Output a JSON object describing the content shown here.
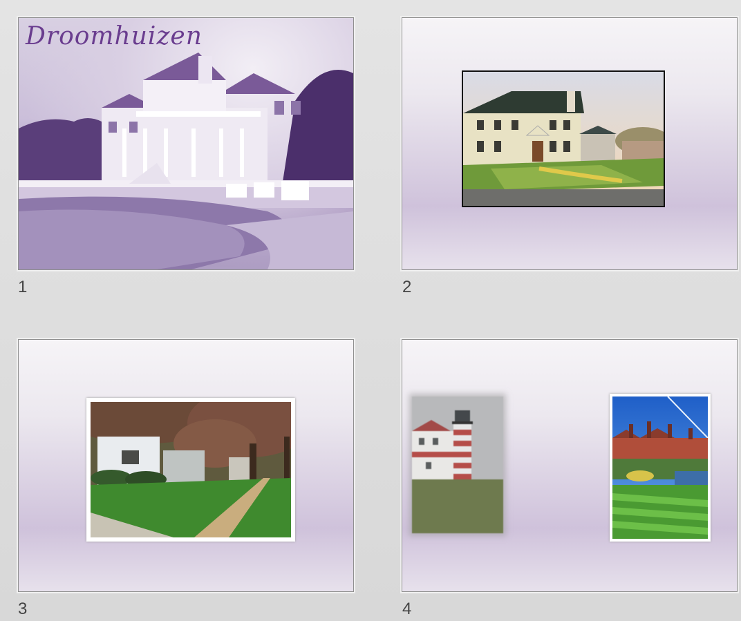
{
  "slides": [
    {
      "number": "1",
      "title": "Droomhuizen",
      "thumbnail": "house-with-pool-purple-tint"
    },
    {
      "number": "2",
      "thumbnail": "colonial-house-photo"
    },
    {
      "number": "3",
      "thumbnail": "tree-lined-house-photo"
    },
    {
      "number": "4",
      "thumbnail": "lighthouse-and-estate-photos"
    }
  ],
  "colors": {
    "background": "#d8d8d8",
    "slide_border": "#8f8f8f",
    "title_purple": "#6a3d8f",
    "slide_gradient_bottom": "#cfc2db"
  }
}
